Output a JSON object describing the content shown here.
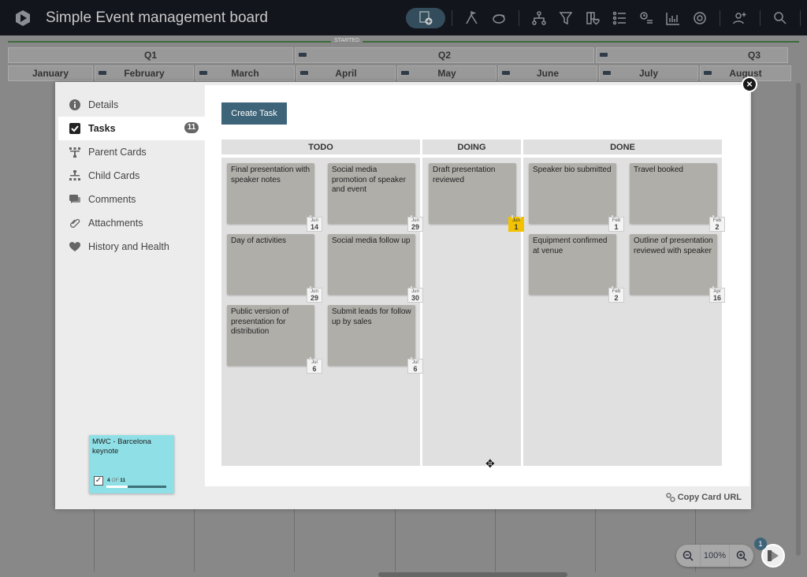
{
  "app": {
    "title": "Simple Event management board"
  },
  "toolbar": {
    "icons": [
      "add-card-icon",
      "goals-icon",
      "tags-icon",
      "connections-icon",
      "filter-icon",
      "board-health-icon",
      "list-icon",
      "timeline-icon",
      "analytics-icon",
      "settings-icon",
      "invite-user-icon",
      "search-icon"
    ]
  },
  "timeline": {
    "status_label": "STARTED",
    "quarters": [
      "Q1",
      "Q2",
      "Q3"
    ],
    "months": [
      "January",
      "February",
      "March",
      "April",
      "May",
      "June",
      "July",
      "August"
    ]
  },
  "modal": {
    "close_label": "×",
    "nav": [
      {
        "label": "Details",
        "icon": "info-icon"
      },
      {
        "label": "Tasks",
        "icon": "checkbox-icon",
        "badge": "11",
        "active": true
      },
      {
        "label": "Parent Cards",
        "icon": "parent-cards-icon"
      },
      {
        "label": "Child Cards",
        "icon": "child-cards-icon"
      },
      {
        "label": "Comments",
        "icon": "comments-icon"
      },
      {
        "label": "Attachments",
        "icon": "paperclip-icon"
      },
      {
        "label": "History and Health",
        "icon": "history-health-icon"
      }
    ],
    "parent_card": {
      "title": "MWC - Barcelona keynote",
      "completed": "4",
      "of_label": "OF",
      "total": "11",
      "progress": 0.36
    },
    "create_task_label": "Create Task",
    "lanes": [
      {
        "title": "TODO",
        "tasks": [
          {
            "title": "Final presentation with speaker notes",
            "month": "Jun",
            "day": "14"
          },
          {
            "title": "Social media promotion of speaker and event",
            "month": "Jun",
            "day": "29"
          },
          {
            "title": "Day of activities",
            "month": "Jun",
            "day": "29"
          },
          {
            "title": "Social media follow up",
            "month": "Jun",
            "day": "30"
          },
          {
            "title": "Public version of presentation for distribution",
            "month": "Jul",
            "day": "6"
          },
          {
            "title": "Submit leads for follow up by sales",
            "month": "Jul",
            "day": "6"
          }
        ]
      },
      {
        "title": "DOING",
        "tasks": [
          {
            "title": "Draft presentation reviewed",
            "month": "Jun",
            "day": "1",
            "due": true
          }
        ]
      },
      {
        "title": "DONE",
        "tasks": [
          {
            "title": "Speaker bio submitted",
            "month": "Feb",
            "day": "1"
          },
          {
            "title": "Travel booked",
            "month": "Feb",
            "day": "2"
          },
          {
            "title": "Equipment confirmed at venue",
            "month": "Feb",
            "day": "2"
          },
          {
            "title": "Outline of presentation reviewed with speaker",
            "month": "Apr",
            "day": "16"
          }
        ]
      }
    ],
    "copy_url_label": "Copy Card URL"
  },
  "zoom_widget": {
    "value": "100%"
  },
  "notifications": {
    "count": "1"
  }
}
